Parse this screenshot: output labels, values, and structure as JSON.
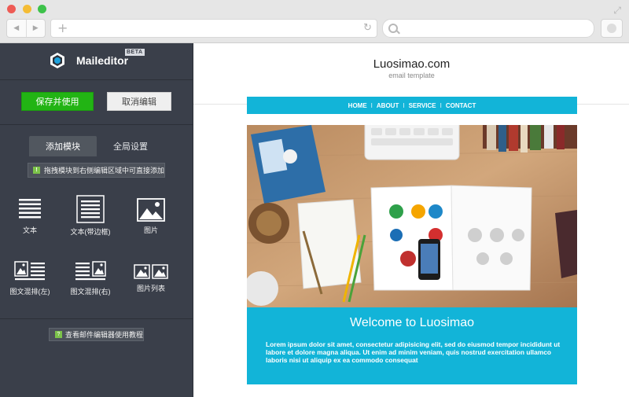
{
  "browser": {
    "back_icon": "◀",
    "forward_icon": "▶",
    "new_tab_icon": "+",
    "reload_icon": "↻",
    "fullscreen_icon": "⤢"
  },
  "sidebar": {
    "brand": "Maileditor",
    "beta": "BETA",
    "save_label": "保存并使用",
    "cancel_label": "取消编辑",
    "tabs": [
      {
        "label": "添加模块"
      },
      {
        "label": "全局设置"
      }
    ],
    "hint": "拖拽模块到右侧编辑区域中可直接添加",
    "modules": [
      {
        "label": "文本"
      },
      {
        "label": "文本(带边框)"
      },
      {
        "label": "图片"
      },
      {
        "label": "图文混排(左)"
      },
      {
        "label": "图文混排(右)"
      },
      {
        "label": "图片列表"
      }
    ],
    "help": "查看邮件编辑器使用教程"
  },
  "preview": {
    "site_title": "Luosimao.com",
    "site_subtitle": "email template",
    "menu": [
      {
        "label": "HOME"
      },
      {
        "label": "ABOUT"
      },
      {
        "label": "SERVICE"
      },
      {
        "label": "CONTACT"
      }
    ],
    "menu_separator": "I",
    "welcome_title": "Welcome to Luosimao",
    "welcome_text": "Lorem ipsum dolor sit amet, consectetur adipisicing elit, sed do eiusmod tempor incididunt ut labore et dolore magna aliqua. Ut enim ad minim veniam, quis nostrud exercitation ullamco laboris nisi ut aliquip ex ea commodo consequat"
  },
  "colors": {
    "sidebar_bg": "#3a3f4a",
    "save_green": "#22b414",
    "accent_cyan": "#12b4d8"
  }
}
